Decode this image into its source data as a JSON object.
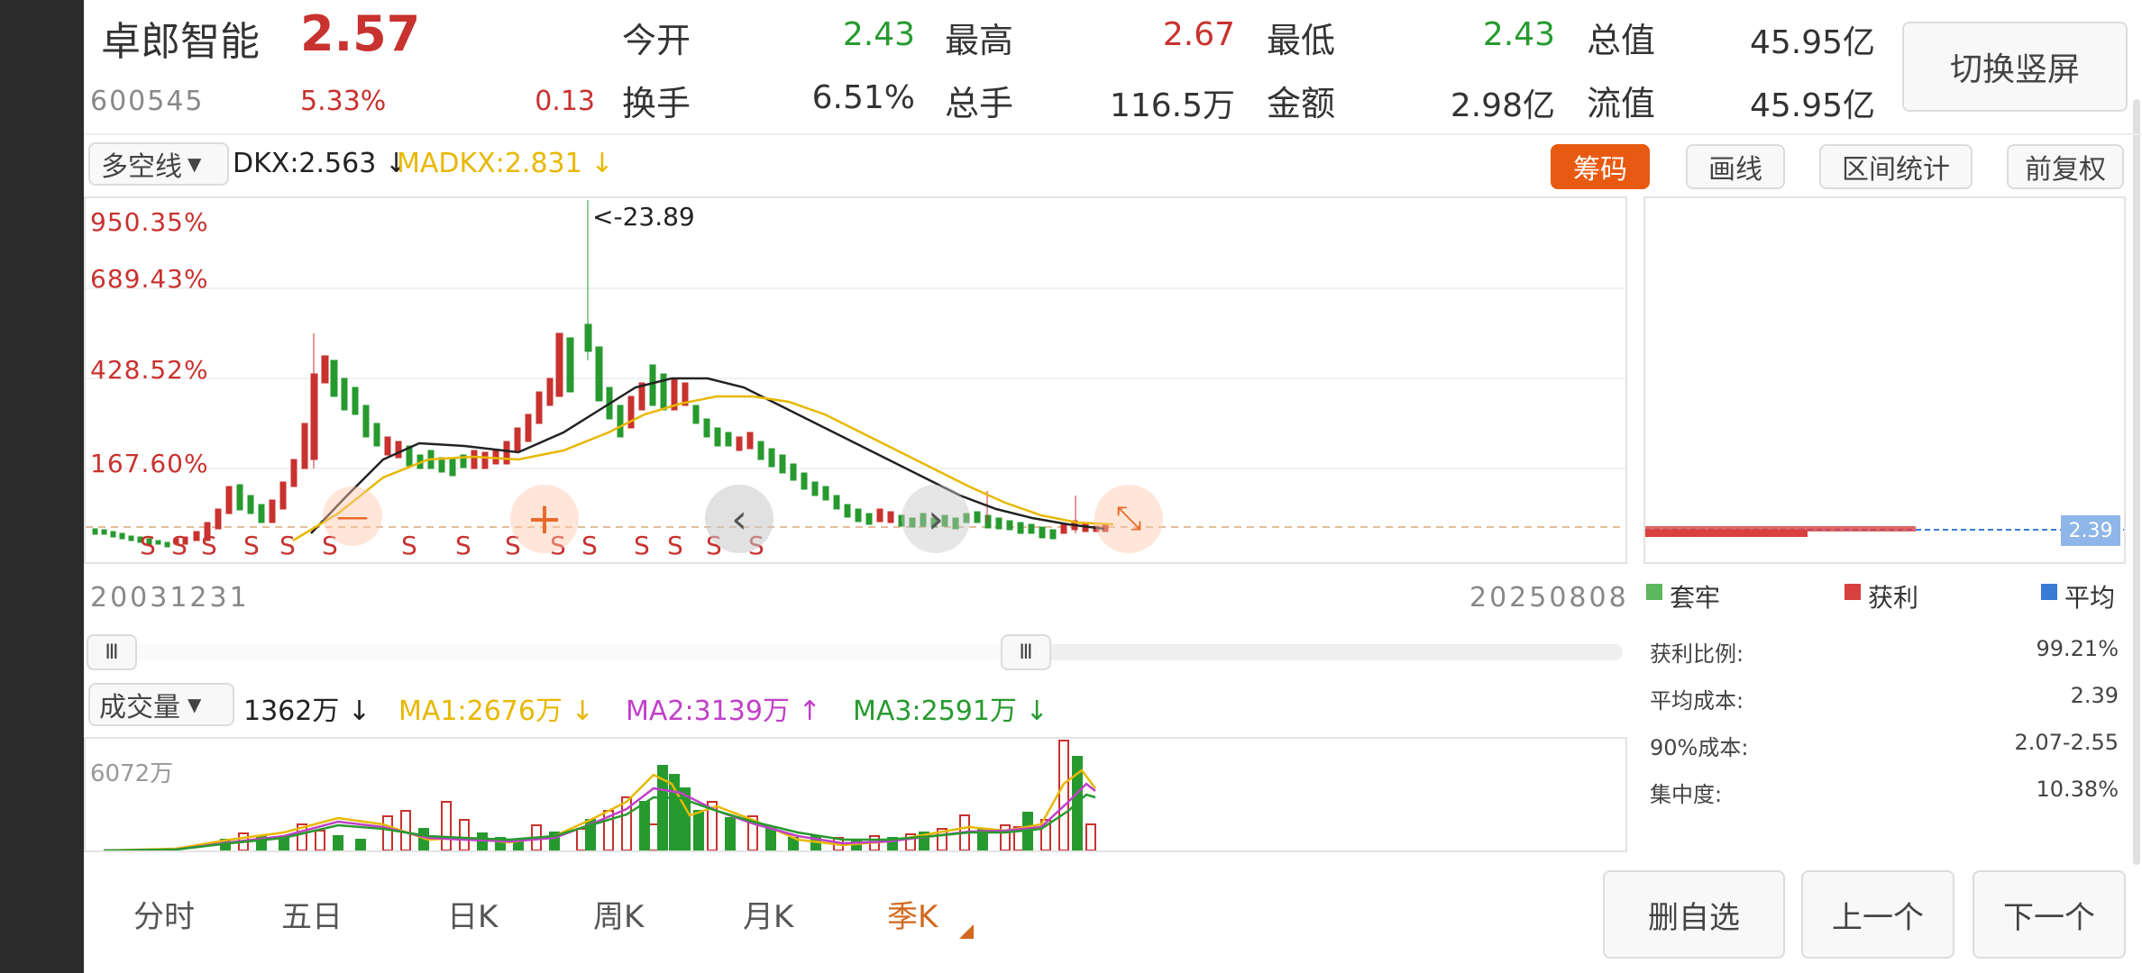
{
  "quote": {
    "name": "卓郎智能",
    "price": "2.57",
    "code": "600545",
    "change_pct": "5.33%",
    "change": "0.13",
    "open_label": "今开",
    "open_value": "2.43",
    "high_label": "最高",
    "high_value": "2.67",
    "low_label": "最低",
    "low_value": "2.43",
    "total_value_label": "总值",
    "total_value": "45.95亿",
    "turnover_label": "换手",
    "turnover_value": "6.51%",
    "volume_label": "总手",
    "volume_value": "116.5万",
    "amount_label": "金额",
    "amount_value": "2.98亿",
    "float_value_label": "流值",
    "float_value": "45.95亿",
    "switch_button": "切换竖屏"
  },
  "indicator_bar": {
    "selector_label": "多空线",
    "dkx_text": "DKX:2.563 ↓",
    "madkx_text": "MADKX:2.831 ↓",
    "chips_button": "筹码",
    "draw_button": "画线",
    "range_stats_button": "区间统计",
    "adjust_button": "前复权"
  },
  "price_chart": {
    "axis_labels": [
      "950.35%",
      "689.43%",
      "428.52%",
      "167.60%"
    ],
    "peak_annotation": "<-23.89",
    "signal_label": "S",
    "start_date": "20031231",
    "end_date": "20250808"
  },
  "volume_bar": {
    "selector_label": "成交量",
    "vol_text": "1362万 ↓",
    "ma1_text": "MA1:2676万 ↓",
    "ma2_text": "MA2:3139万 ↑",
    "ma3_text": "MA3:2591万 ↓",
    "max_label": "6072万"
  },
  "chips_panel": {
    "price_tag": "2.39",
    "legend_trapped": "套牢",
    "legend_profit": "获利",
    "legend_average": "平均",
    "profit_ratio_label": "获利比例:",
    "profit_ratio_value": "99.21%",
    "avg_cost_label": "平均成本:",
    "avg_cost_value": "2.39",
    "cost90_label": "90%成本:",
    "cost90_value": "2.07-2.55",
    "concentration_label": "集中度:",
    "concentration_value": "10.38%"
  },
  "bottom_tabs": {
    "intraday": "分时",
    "five_day": "五日",
    "daily": "日K",
    "weekly": "周K",
    "monthly": "月K",
    "quarterly": "季K",
    "active": "季K"
  },
  "bottom_buttons": {
    "remove_watch": "删自选",
    "previous": "上一个",
    "next": "下一个"
  },
  "colors": {
    "up_red": "#c8322f",
    "down_green": "#279a2f",
    "dkx_black": "#222222",
    "madkx_yellow": "#e8b800",
    "ma2_magenta": "#c040c8",
    "chips_orange": "#e85a12",
    "active_tab": "#d2691e",
    "avg_blue": "#3a7bd5"
  }
}
